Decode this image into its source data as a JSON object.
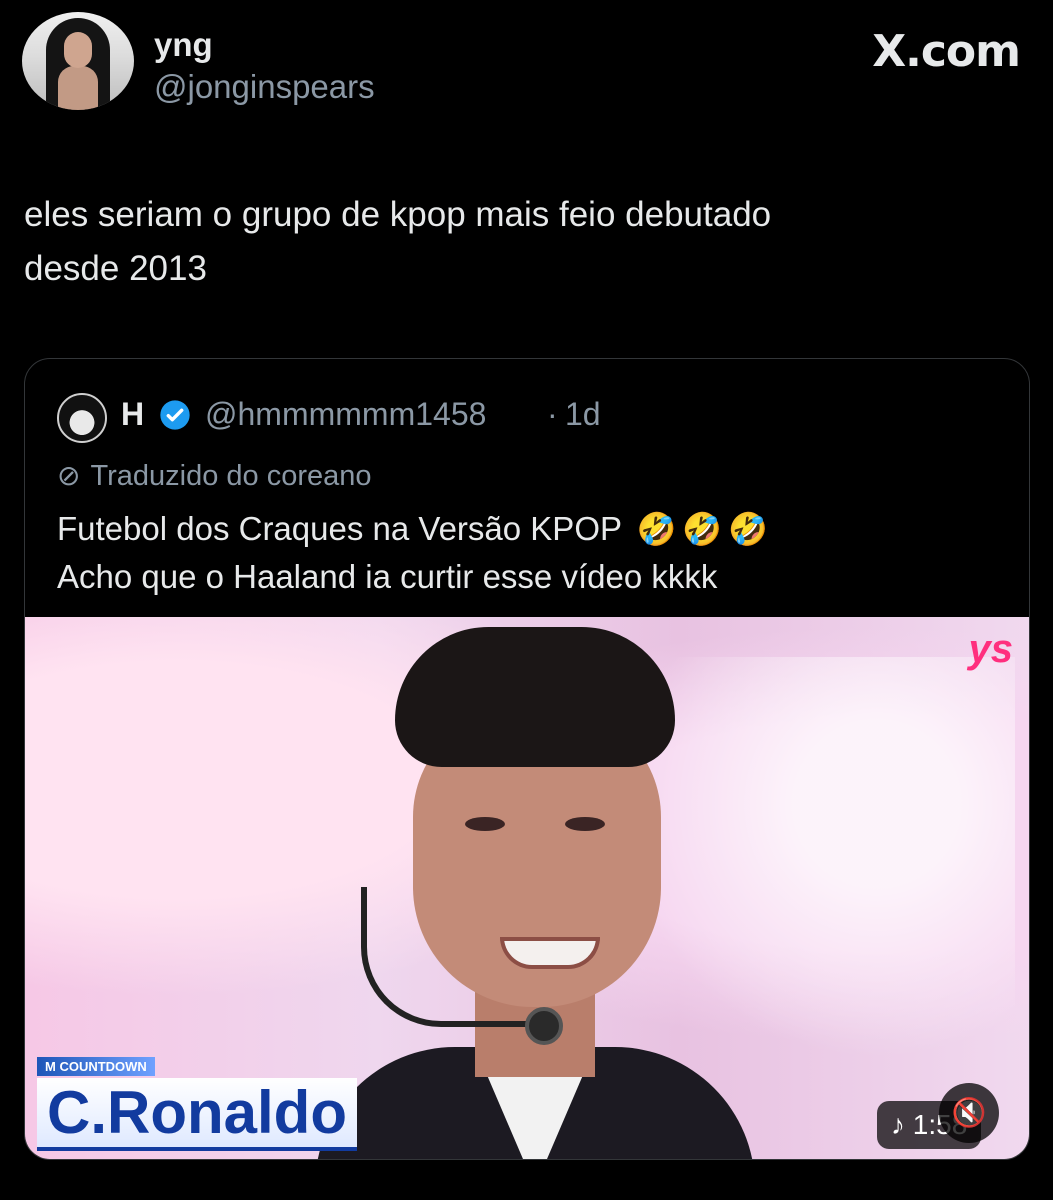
{
  "author": {
    "display_name": "yng",
    "handle": "@jonginspears"
  },
  "brand": "X.com",
  "tweet_text_lines": [
    "eles seriam o grupo de kpop mais feio debutado",
    "desde 2013"
  ],
  "quote": {
    "author_name": "H",
    "handle": "@hmmmmmm1458",
    "separator": "·",
    "time": "1d",
    "translated_label": "Traduzido do coreano",
    "text_line1": "Futebol dos Craques na Versão KPOP",
    "text_line2": "Acho que o Haaland ia curtir esse vídeo kkkk",
    "emojis": [
      "🤣",
      "🤣",
      "🤣"
    ]
  },
  "media": {
    "lower_third_small": "M COUNTDOWN",
    "lower_third_name": "C.Ronaldo",
    "duration": "♪ 1:58",
    "mute_icon": "🔇",
    "corner_logo": "ys"
  },
  "colors": {
    "background": "#000000",
    "text_primary": "#e7e9ea",
    "text_secondary": "#8b98a5",
    "verified_blue": "#1d9bf0"
  }
}
